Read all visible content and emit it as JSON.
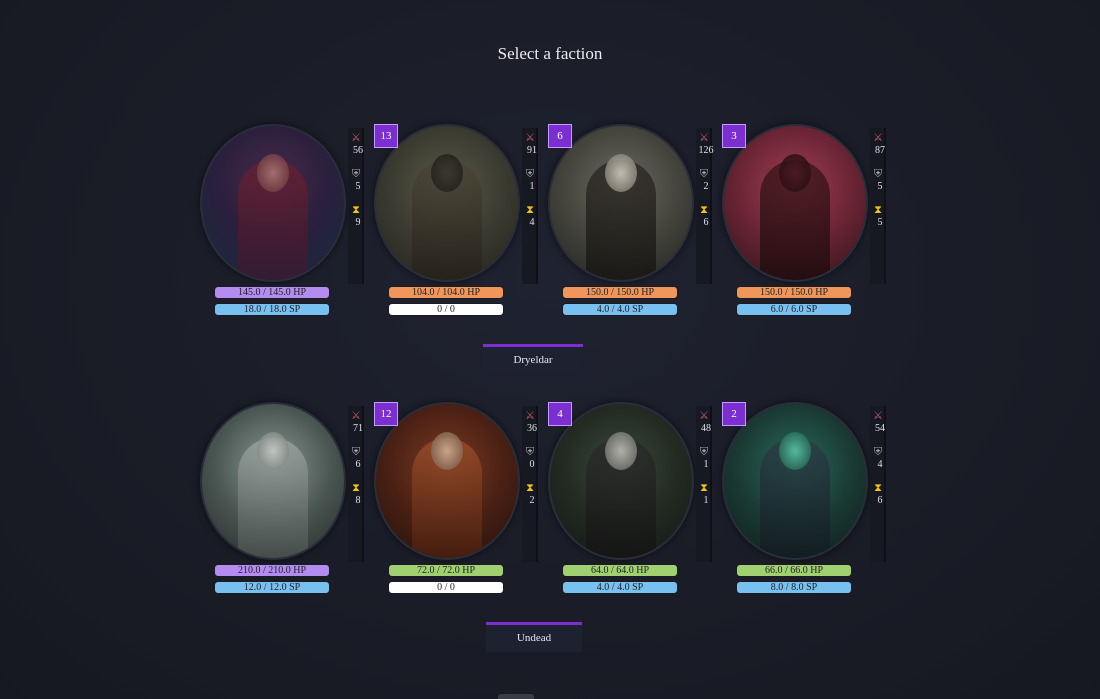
{
  "title": "Select a faction",
  "colors": {
    "accent": "#7b2fd0",
    "hp_purple": "#b48cf0",
    "hp_orange": "#f0965a",
    "hp_green": "#a0d070",
    "sp_blue": "#78c0f0",
    "sp_empty": "#ffffff"
  },
  "factions": [
    {
      "name": "Dryeldar",
      "units": [
        {
          "level": "",
          "attack": "56",
          "defense": "5",
          "speed": "9",
          "hp": "145.0 / 145.0 HP",
          "sp": "18.0 / 18.0 SP",
          "hp_color": "#b48cf0",
          "sp_color": "#78c0f0",
          "portrait": "red-haired-sorceress"
        },
        {
          "level": "13",
          "attack": "91",
          "defense": "1",
          "speed": "4",
          "hp": "104.0 / 104.0 HP",
          "sp": "0 / 0",
          "hp_color": "#f0965a",
          "sp_color": "#ffffff",
          "portrait": "beast-hunter"
        },
        {
          "level": "6",
          "attack": "126",
          "defense": "2",
          "speed": "6",
          "hp": "150.0 / 150.0 HP",
          "sp": "4.0 / 4.0 SP",
          "hp_color": "#f0965a",
          "sp_color": "#78c0f0",
          "portrait": "horned-demon"
        },
        {
          "level": "3",
          "attack": "87",
          "defense": "5",
          "speed": "5",
          "hp": "150.0 / 150.0 HP",
          "sp": "6.0 / 6.0 SP",
          "hp_color": "#f0965a",
          "sp_color": "#78c0f0",
          "portrait": "tentacle-witch"
        }
      ]
    },
    {
      "name": "Undead",
      "units": [
        {
          "level": "",
          "attack": "71",
          "defense": "6",
          "speed": "8",
          "hp": "210.0 / 210.0 HP",
          "sp": "12.0 / 12.0 SP",
          "hp_color": "#b48cf0",
          "sp_color": "#78c0f0",
          "portrait": "crowned-king"
        },
        {
          "level": "12",
          "attack": "36",
          "defense": "0",
          "speed": "2",
          "hp": "72.0 / 72.0 HP",
          "sp": "0 / 0",
          "hp_color": "#a0d070",
          "sp_color": "#ffffff",
          "portrait": "skeleton-warrior"
        },
        {
          "level": "4",
          "attack": "48",
          "defense": "1",
          "speed": "1",
          "hp": "64.0 / 64.0 HP",
          "sp": "4.0 / 4.0 SP",
          "hp_color": "#a0d070",
          "sp_color": "#78c0f0",
          "portrait": "ghoul-necromancer"
        },
        {
          "level": "2",
          "attack": "54",
          "defense": "4",
          "speed": "6",
          "hp": "66.0 / 66.0 HP",
          "sp": "8.0 / 8.0 SP",
          "hp_color": "#a0d070",
          "sp_color": "#78c0f0",
          "portrait": "lich-mage"
        }
      ]
    }
  ]
}
